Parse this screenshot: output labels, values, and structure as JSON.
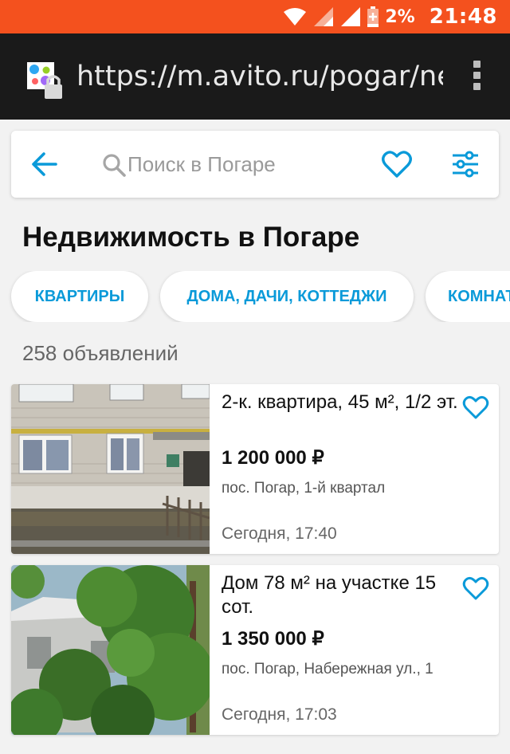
{
  "status_bar": {
    "battery": "2%",
    "time": "21:48"
  },
  "browser": {
    "url": "https://m.avito.ru/pogar/ne",
    "site_icon": "avito-logo-with-lock-icon",
    "menu_icon": "overflow-menu-icon"
  },
  "search": {
    "placeholder": "Поиск в Погаре",
    "back_icon": "back-arrow-icon",
    "search_icon": "search-icon",
    "favorites_icon": "heart-icon",
    "filter_icon": "sliders-filter-icon"
  },
  "page": {
    "title": "Недвижимость в Погаре",
    "results_count": "258 объявлений"
  },
  "categories": [
    {
      "label": "КВАРТИРЫ"
    },
    {
      "label": "ДОМА, ДАЧИ, КОТТЕДЖИ"
    },
    {
      "label": "КОМНАТЫ"
    }
  ],
  "listings": [
    {
      "title": "2-к. квартира, 45 м², 1/2 эт.",
      "price": "1 200 000 ₽",
      "address": "пос. Погар, 1-й квартал",
      "date": "Сегодня, 17:40",
      "photo": "brick-apartment-building-photo"
    },
    {
      "title": "Дом 78 м² на участке 15 сот.",
      "price": "1 350 000 ₽",
      "address": "пос. Погар, Набережная ул., 1",
      "date": "Сегодня, 17:03",
      "photo": "house-behind-trees-photo"
    }
  ],
  "colors": {
    "status_bar": "#f4511e",
    "browser_bar": "#1a1a1a",
    "accent": "#0a9ad9",
    "background": "#f2f2f2"
  }
}
